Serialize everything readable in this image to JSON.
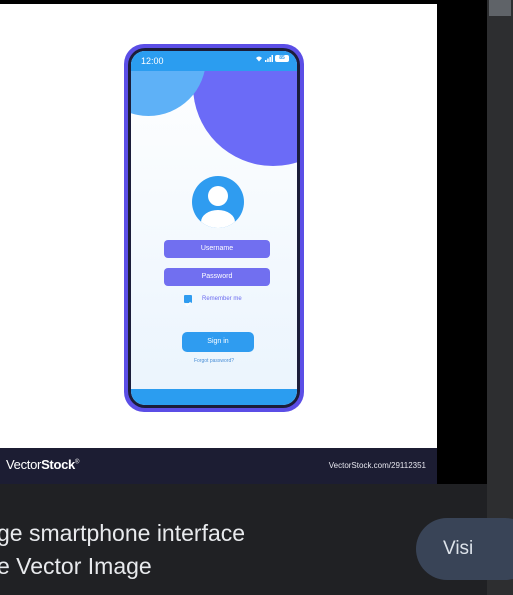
{
  "phone": {
    "status_time": "12:00",
    "battery_level": "85",
    "username_placeholder": "Username",
    "password_placeholder": "Password",
    "remember_label": "Remember me",
    "remember_checked": true,
    "signin_label": "Sign in",
    "forgot_label": "Forgot password?"
  },
  "watermark": {
    "brand_light": "Vector",
    "brand_bold": "Stock",
    "brand_mark": "®",
    "url": "VectorStock.com/29112351"
  },
  "caption": {
    "line1": "ge smartphone interface",
    "line2": "e Vector Image"
  },
  "visit_button": {
    "label": "Visi"
  },
  "colors": {
    "phone_frame": "#5b4ee6",
    "accent_blue": "#2f9cf0",
    "field_purple": "#716ff0",
    "page_bg": "#202124",
    "visit_bg": "#394457"
  }
}
